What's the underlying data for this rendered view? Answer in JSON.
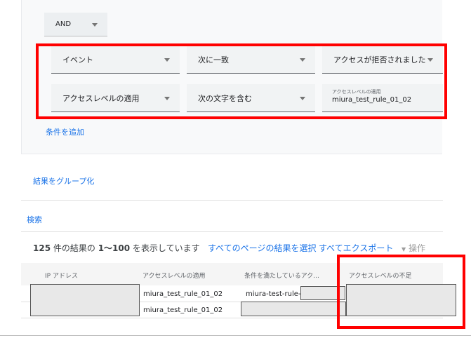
{
  "filter": {
    "operator": "AND",
    "row1": {
      "field": "イベント",
      "condition": "次に一致",
      "value": "アクセスが拒否されました"
    },
    "row2": {
      "field": "アクセスレベルの適用",
      "condition": "次の文字を含む",
      "value_label": "アクセスレベルの適用",
      "value": "miura_test_rule_01_02"
    },
    "add_condition": "条件を追加"
  },
  "group_results": "結果をグループ化",
  "search": "検索",
  "results": {
    "summary_count": "125",
    "summary_text": " 件の結果の ",
    "summary_range": "1〜100",
    "summary_tail": " を表示しています",
    "select_all_pages": "すべてのページの結果を選択",
    "export_all": "すべてエクスポート",
    "actions": "操作"
  },
  "table": {
    "headers": [
      "IP アドレス",
      "アクセスレベルの適用",
      "条件を満たしているアク...",
      "アクセスレベルの不足"
    ],
    "rows": [
      {
        "access_level": "miura_test_rule_01_02",
        "matched": "miura-test-rule-01"
      },
      {
        "access_level": "miura_test_rule_01_02",
        "matched": ""
      }
    ]
  }
}
